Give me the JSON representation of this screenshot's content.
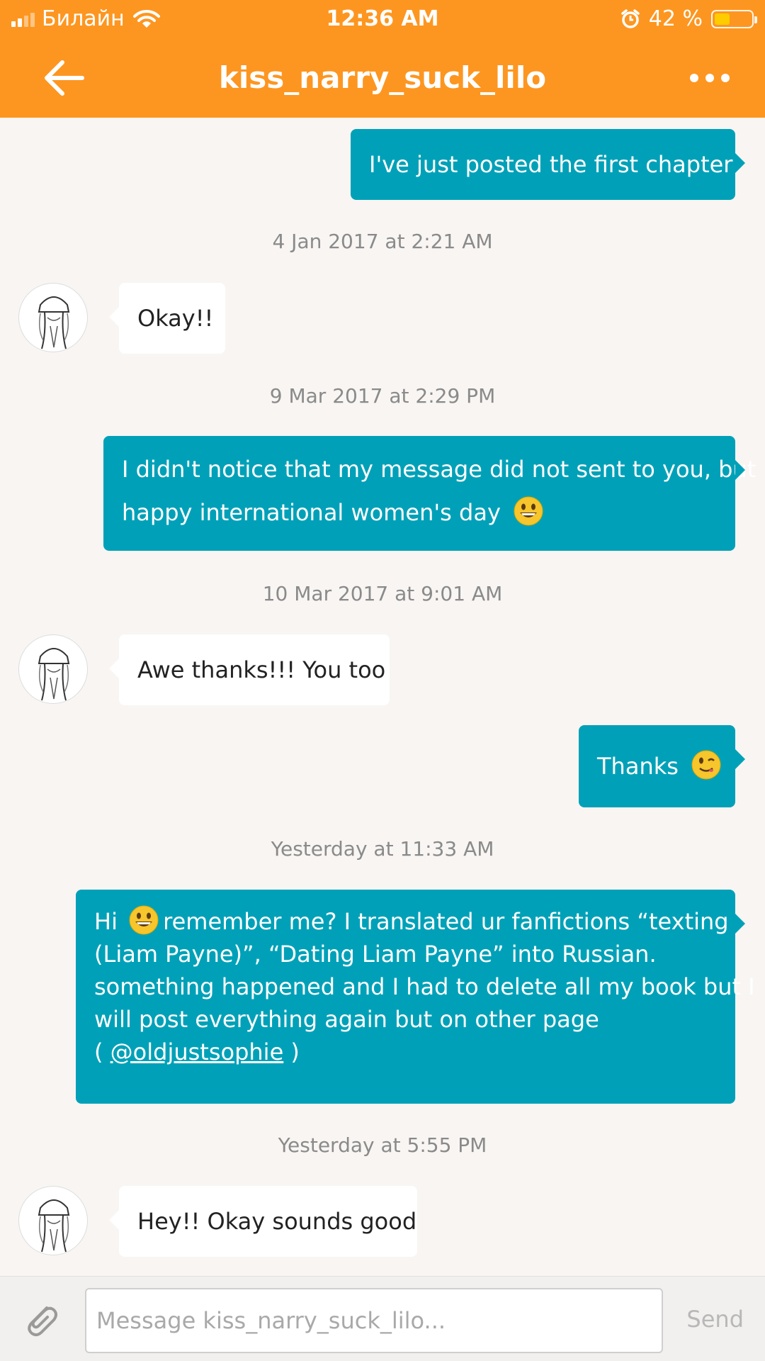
{
  "status_bar": {
    "carrier": "Билайн",
    "time": "12:36 AM",
    "battery_percent": "42 %",
    "battery_level": 0.42
  },
  "nav": {
    "title": "kiss_narry_suck_lilo"
  },
  "messages": [
    {
      "type": "out",
      "lines": [
        "I've  just posted the first chapter"
      ]
    },
    {
      "type": "time",
      "text": "4 Jan 2017 at 2:21 AM"
    },
    {
      "type": "in",
      "lines": [
        "Okay!!"
      ]
    },
    {
      "type": "time",
      "text": "9 Mar 2017 at 2:29 PM"
    },
    {
      "type": "out",
      "lines": [
        "I didn't notice that my message did not sent to you, but",
        "happy international women's day"
      ]
    },
    {
      "type": "time",
      "text": "10 Mar 2017 at 9:01 AM"
    },
    {
      "type": "in",
      "lines": [
        "Awe thanks!!! You too"
      ]
    },
    {
      "type": "out",
      "lines": [
        "Thanks"
      ]
    },
    {
      "type": "time",
      "text": "Yesterday at 11:33 AM"
    },
    {
      "type": "out",
      "lines": [
        "Hi",
        "remember me? I translated ur fanfictions “texting",
        "(Liam Payne)”, “Dating Liam Payne” into Russian.",
        "something happened and I had to delete all my book but I",
        "will post everything again but on other page",
        "(",
        "@oldjustsophie",
        ")"
      ]
    },
    {
      "type": "time",
      "text": "Yesterday at 5:55 PM"
    },
    {
      "type": "in",
      "lines": [
        "Hey!! Okay sounds good"
      ]
    }
  ],
  "composer": {
    "placeholder": "Message kiss_narry_suck_lilo...",
    "send_label": "Send"
  },
  "icons": {
    "back": "arrow-left-icon",
    "more": "ellipsis-icon",
    "attach": "paperclip-icon",
    "emoji_grin": "grinning-face-emoji",
    "emoji_wink": "winking-face-emoji"
  },
  "colors": {
    "header": "#fd9620",
    "outgoing_bubble": "#00a1b8",
    "incoming_bubble": "#ffffff",
    "background": "#f8f5f3"
  }
}
